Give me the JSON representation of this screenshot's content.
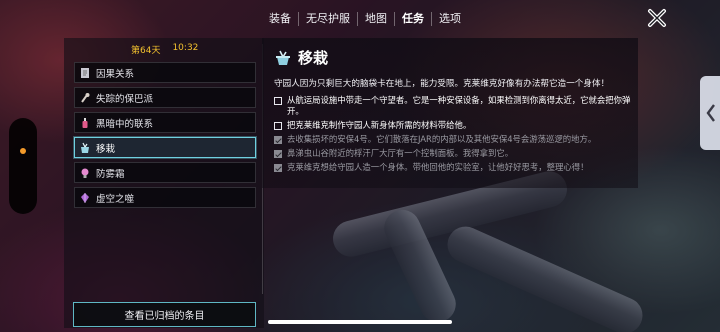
{
  "nav": {
    "tabs": [
      "装备",
      "无尽护服",
      "地图",
      "任务",
      "选项"
    ],
    "active_index": 3
  },
  "status": {
    "day": "第64天",
    "time": "10:32"
  },
  "quests": [
    {
      "label": "因果关系",
      "icon": "document-icon",
      "icon_color": "#c9c9d2"
    },
    {
      "label": "失踪的保巴派",
      "icon": "tool-icon",
      "icon_color": "#d8d0c8"
    },
    {
      "label": "黑暗中的联系",
      "icon": "bottle-icon",
      "icon_color": "#e05a8a"
    },
    {
      "label": "移栽",
      "icon": "pot-icon",
      "icon_color": "#9ad7e6"
    },
    {
      "label": "防雾霜",
      "icon": "bulb-icon",
      "icon_color": "#e58ad0"
    },
    {
      "label": "虚空之噬",
      "icon": "crystal-icon",
      "icon_color": "#b06ad8"
    }
  ],
  "active_quest_index": 3,
  "archive_button": "查看已归档的条目",
  "detail": {
    "title": "移栽",
    "description": "守园人因为只剩巨大的脑袋卡在地上，能力受限。克莱维克好像有办法帮它造一个身体！",
    "objectives": [
      {
        "text": "从航运局设施中带走一个守望者。它是一种安保设备，如果检测到你离得太近，它就会把你弹开。",
        "done": false
      },
      {
        "text": "把克莱维克制作守园人新身体所需的材料带给他。",
        "done": false
      },
      {
        "text": "去收集损坏的安保4号。它们散落在JAR的内部以及其他安保4号会游荡巡逻的地方。",
        "done": true
      },
      {
        "text": "鼻涕虫山谷附近的桴汗厂大厅有一个控制面板。我得拿到它。",
        "done": true
      },
      {
        "text": "克莱维克想给守园人造一个身体。带他回他的实验室，让他好好思考，整理心得！",
        "done": true
      }
    ]
  },
  "colors": {
    "accent": "#6fd0e0",
    "date": "#f2c12e",
    "side_dot": "#f39a2a"
  }
}
